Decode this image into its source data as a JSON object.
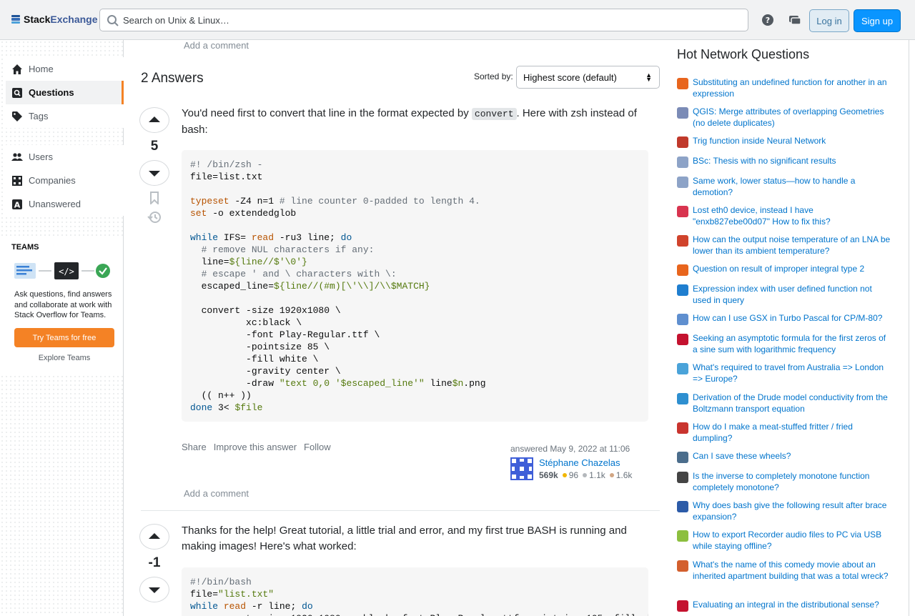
{
  "topbar": {
    "logo_text_a": "Stack",
    "logo_text_b": "Exchange",
    "search_placeholder": "Search on Unix & Linux…",
    "help_icon": "help-icon",
    "inbox_icon": "inbox-icon",
    "login_label": "Log in",
    "signup_label": "Sign up"
  },
  "sidebar": {
    "items": [
      {
        "label": "Home",
        "icon": "home-icon"
      },
      {
        "label": "Questions",
        "icon": "questions-icon"
      },
      {
        "label": "Tags",
        "icon": "tag-icon"
      },
      {
        "label": "Users",
        "icon": "users-icon"
      },
      {
        "label": "Companies",
        "icon": "companies-icon"
      },
      {
        "label": "Unanswered",
        "icon": "unanswered-icon"
      }
    ],
    "teams": {
      "title": "TEAMS",
      "description": "Ask questions, find answers and collaborate at work with Stack Overflow for Teams.",
      "try_label": "Try Teams for free",
      "explore_label": "Explore Teams"
    }
  },
  "main": {
    "add_comment_top": "Add a comment",
    "answers_count": "2",
    "answers_word": "Answers",
    "sorted_label": "Sorted by:",
    "sort_value": "Highest score (default)",
    "answer1": {
      "score": "5",
      "text_before": "You'd need first to convert that line in the format expected by ",
      "inline_code": "convert",
      "text_after": ". Here with zsh instead of bash:",
      "share": "Share",
      "improve": "Improve this answer",
      "follow": "Follow",
      "answered_label": "answered",
      "answered_date": "May 9, 2022 at 11:06",
      "author": "Stéphane Chazelas",
      "reputation": "569k",
      "gold": "96",
      "silver": "1.1k",
      "bronze": "1.6k",
      "add_comment": "Add a comment"
    },
    "answer2": {
      "score": "-1",
      "text": "Thanks for the help! Great tutorial, a little trial and error, and my first true BASH is running and making images! Here's what worked:"
    }
  },
  "hnq": {
    "title": "Hot Network Questions",
    "items": [
      {
        "text": "Substituting an undefined function for another in an expression",
        "color": "#e8651d"
      },
      {
        "text": "QGIS: Merge attributes of overlapping Geometries (no delete duplicates)",
        "color": "#7b8bb6"
      },
      {
        "text": "Trig function inside Neural Network",
        "color": "#c0392b"
      },
      {
        "text": "BSc: Thesis with no significant results",
        "color": "#8da3c7"
      },
      {
        "text": "Same work, lower status—how to handle a demotion?",
        "color": "#8da3c7"
      },
      {
        "text": "Lost eth0 device, instead I have \"enxb827ebe00d07\" How to fix this?",
        "color": "#d8344f"
      },
      {
        "text": "How can the output noise temperature of an LNA be lower than its ambient temperature?",
        "color": "#d0432c"
      },
      {
        "text": "Question on result of improper integral type 2",
        "color": "#e8651d"
      },
      {
        "text": "Expression index with user defined function not used in query",
        "color": "#1f7ecf"
      },
      {
        "text": "How can I use GSX in Turbo Pascal for CP/M-80?",
        "color": "#5f8fcf"
      },
      {
        "text": "Seeking an asymptotic formula for the first zeros of a sine sum with logarithmic frequency",
        "color": "#c4122f"
      },
      {
        "text": "What's required to travel from Australia => London => Europe?",
        "color": "#4aa3d9"
      },
      {
        "text": "Derivation of the Drude model conductivity from the Boltzmann transport equation",
        "color": "#2e8fd0"
      },
      {
        "text": "How do I make a meat-stuffed fritter / fried dumpling?",
        "color": "#c9342e"
      },
      {
        "text": "Can I save these wheels?",
        "color": "#4b6d8c"
      },
      {
        "text": "Is the inverse to completely monotone function completely monotone?",
        "color": "#444444"
      },
      {
        "text": "Why does bash give the following result after brace expansion?",
        "color": "#2c5ba8"
      },
      {
        "text": "How to export Recorder audio files to PC via USB while staying offline?",
        "color": "#8cbf3f"
      },
      {
        "text": "What's the name of this comedy movie about an inherited apartment building that was a total wreck?",
        "color": "#d35f2d"
      },
      {
        "text": "Evaluating an integral in the distributional sense?",
        "color": "#c4122f"
      }
    ]
  }
}
